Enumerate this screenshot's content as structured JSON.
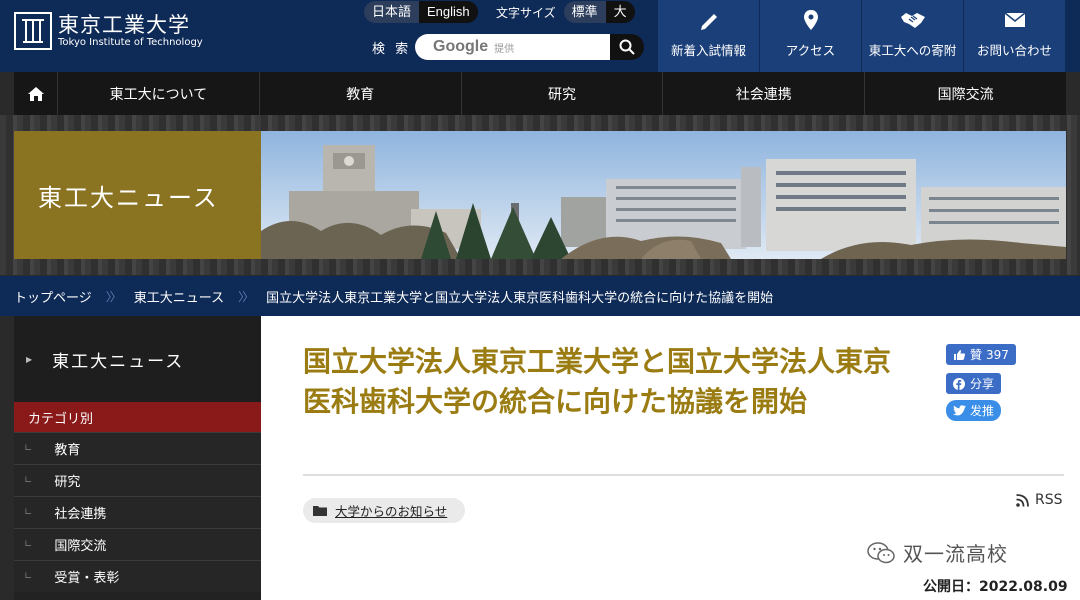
{
  "header": {
    "logo_jp": "東京工業大学",
    "logo_en": "Tokyo Institute of Technology",
    "lang": {
      "ja": "日本語",
      "en": "English"
    },
    "font_size": {
      "label": "文字サイズ",
      "standard": "標準",
      "large": "大"
    },
    "search": {
      "label": "検 索",
      "google": "Google",
      "provided": "提供"
    },
    "quick_links": [
      {
        "label": "新着入試情報",
        "icon": "pencil-icon"
      },
      {
        "label": "アクセス",
        "icon": "map-pin-icon"
      },
      {
        "label": "東工大への寄附",
        "icon": "handshake-icon"
      },
      {
        "label": "お問い合わせ",
        "icon": "envelope-icon"
      }
    ]
  },
  "nav": {
    "items": [
      "東工大について",
      "教育",
      "研究",
      "社会連携",
      "国際交流"
    ]
  },
  "banner": {
    "title": "東工大ニュース"
  },
  "breadcrumb": [
    "トップページ",
    "東工大ニュース",
    "国立大学法人東京工業大学と国立大学法人東京医科歯科大学の統合に向けた協議を開始"
  ],
  "sidebar": {
    "heading": "東工大ニュース",
    "category_label": "カテゴリ別",
    "items": [
      "教育",
      "研究",
      "社会連携",
      "国際交流",
      "受賞・表彰"
    ]
  },
  "article": {
    "title": "国立大学法人東京工業大学と国立大学法人東京医科歯科大学の統合に向けた協議を開始",
    "like": {
      "label": "贊",
      "count": "397"
    },
    "share": "分享",
    "tweet": "发推",
    "tag": "大学からのお知らせ",
    "rss": "RSS",
    "watermark": "双一流高校",
    "date": "公開日：2022.08.09"
  },
  "colors": {
    "navy": "#0e2a57",
    "gold": "#8a7321",
    "title_gold": "#9a7c12",
    "category_red": "#8a1a1a"
  }
}
